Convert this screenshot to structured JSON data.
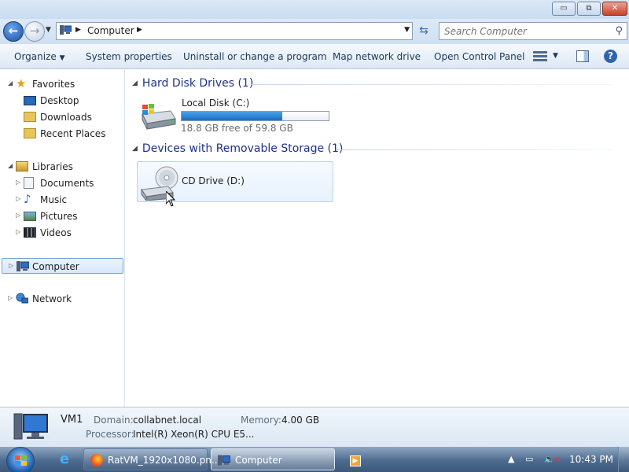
{
  "window": {
    "controls": {
      "minimize": "▭",
      "maximize": "⧉",
      "close": "✕"
    }
  },
  "navbar": {
    "back_glyph": "←",
    "forward_glyph": "→",
    "address_text": "Computer",
    "refresh_glyph": "⇆",
    "search_placeholder": "Search Computer"
  },
  "toolbar": {
    "organize": "Organize",
    "system_properties": "System properties",
    "uninstall": "Uninstall or change a program",
    "map_network_drive": "Map network drive",
    "open_control_panel": "Open Control Panel",
    "help": "?"
  },
  "nav_pane": {
    "favorites": {
      "label": "Favorites",
      "items": [
        {
          "label": "Desktop",
          "icon": "desktop-icon"
        },
        {
          "label": "Downloads",
          "icon": "downloads-folder-icon"
        },
        {
          "label": "Recent Places",
          "icon": "recent-places-icon"
        }
      ]
    },
    "libraries": {
      "label": "Libraries",
      "items": [
        {
          "label": "Documents",
          "icon": "documents-icon"
        },
        {
          "label": "Music",
          "icon": "music-icon"
        },
        {
          "label": "Pictures",
          "icon": "pictures-icon"
        },
        {
          "label": "Videos",
          "icon": "videos-icon"
        }
      ]
    },
    "computer": {
      "label": "Computer",
      "selected": true
    },
    "network": {
      "label": "Network"
    }
  },
  "content": {
    "hard_disk_group": {
      "title": "Hard Disk Drives (1)",
      "drives": [
        {
          "name": "Local Disk (C:)",
          "free_text": "18.8 GB free of 59.8 GB",
          "used_fraction": 0.686
        }
      ]
    },
    "removable_group": {
      "title": "Devices with Removable Storage (1)",
      "drives": [
        {
          "name": "CD Drive (D:)"
        }
      ]
    }
  },
  "details": {
    "computer_name": "VM1",
    "domain_label": "Domain:",
    "domain_value": "collabnet.local",
    "memory_label": "Memory:",
    "memory_value": "4.00 GB",
    "processor_label": "Processor:",
    "processor_value": "Intel(R) Xeon(R) CPU E5..."
  },
  "taskbar": {
    "tasks": [
      {
        "label": "RatVM_1920x1080.pn...",
        "icon": "firefox-icon",
        "active": false
      },
      {
        "label": "Computer",
        "icon": "computer-icon",
        "active": true
      }
    ],
    "clock": "10:43 PM"
  },
  "colors": {
    "accent": "#1e3287",
    "usage_fill": "#1a6cc4",
    "taskbar": "#4d6a8f"
  }
}
